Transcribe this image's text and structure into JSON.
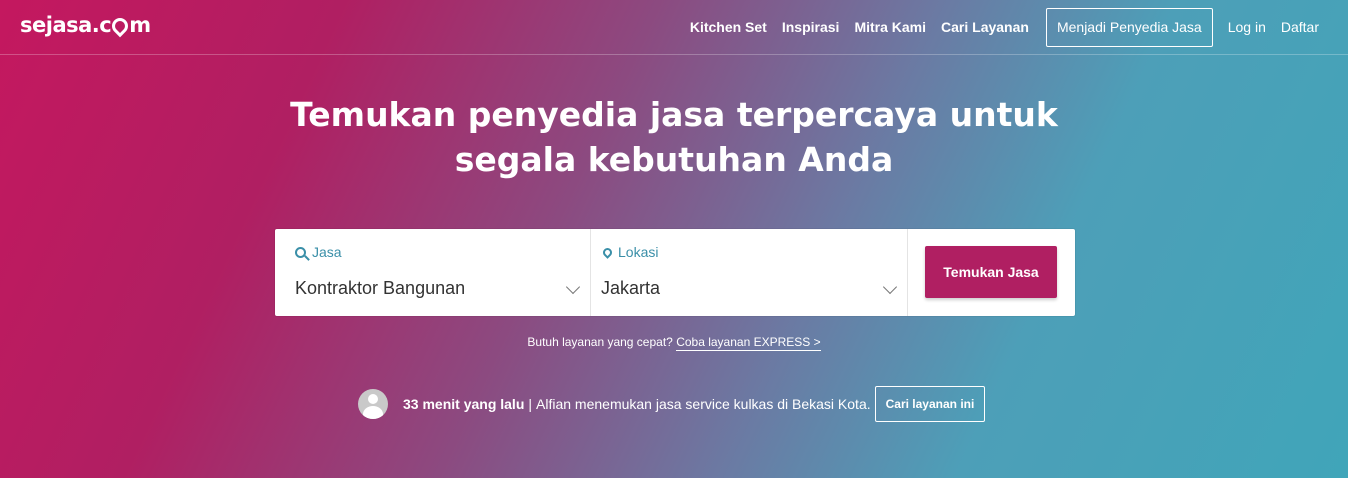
{
  "brand": {
    "name_left": "sejasa.c",
    "name_right": "m"
  },
  "nav": {
    "items": [
      "Kitchen Set",
      "Inspirasi",
      "Mitra Kami",
      "Cari Layanan"
    ],
    "provider_button": "Menjadi Penyedia Jasa",
    "login": "Log in",
    "register": "Daftar"
  },
  "hero": {
    "line1": "Temukan penyedia jasa terpercaya untuk",
    "line2": "segala kebutuhan Anda"
  },
  "search": {
    "service_label": "Jasa",
    "service_value": "Kontraktor Bangunan",
    "location_label": "Lokasi",
    "location_value": "Jakarta",
    "button": "Temukan Jasa"
  },
  "express": {
    "prompt": "Butuh layanan yang cepat?",
    "link": "Coba layanan EXPRESS >"
  },
  "activity": {
    "time": "33 menit yang lalu",
    "separator": "|",
    "message": "Alfian menemukan jasa service kulkas di Bekasi Kota.",
    "button": "Cari layanan ini"
  },
  "colors": {
    "accent": "#b01f62",
    "label": "#3a8fa8"
  }
}
